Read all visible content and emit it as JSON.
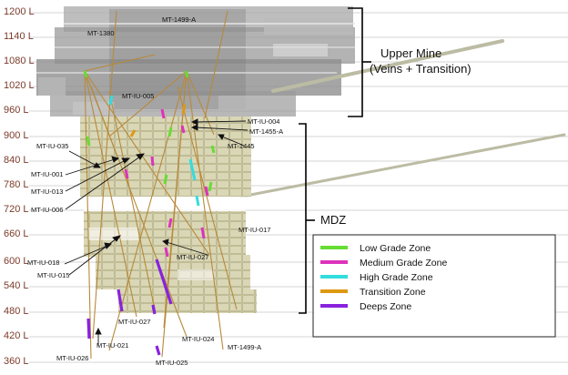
{
  "levels": [
    "1200 L",
    "1140 L",
    "1080 L",
    "1020 L",
    "960 L",
    "900 L",
    "840 L",
    "780 L",
    "720 L",
    "660 L",
    "600 L",
    "540 L",
    "480 L",
    "420 L",
    "360 L"
  ],
  "zones": {
    "upper_mine_title": "Upper Mine",
    "upper_mine_sub": "(Veins + Transition)",
    "mdz": "MDZ"
  },
  "holes": {
    "mt_1499_a_top": "MT-1499-A",
    "mt_1380": "MT-1380",
    "mt_iu_005": "MT-IU-005",
    "mt_iu_004": "MT-IU-004",
    "mt_1455_a": "MT-1455-A",
    "mt_1445": "MT-1445",
    "mt_iu_035": "MT-IU-035",
    "mt_iu_001": "MT-IU-001",
    "mt_iu_013": "MT-IU-013",
    "mt_iu_006": "MT-IU-006",
    "mt_iu_017": "MT-IU-017",
    "mt_iu_018": "MT-IU-018",
    "mt_iu_015": "MT-IU-015",
    "mt_iu_027_mid": "MT-IU-027",
    "mt_iu_027_low": "MT-IU-027",
    "mt_iu_021": "MT-IU-021",
    "mt_iu_024": "MT-IU-024",
    "mt_1499_a_low": "MT-1499-A",
    "mt_iu_026": "MT-IU-026",
    "mt_iu_025": "MT-IU-025"
  },
  "legend": [
    {
      "label": "Low Grade Zone",
      "color": "#66dd33"
    },
    {
      "label": "Medium Grade Zone",
      "color": "#dd33bb"
    },
    {
      "label": "High Grade Zone",
      "color": "#33dddd"
    },
    {
      "label": "Transition Zone",
      "color": "#dd9911"
    },
    {
      "label": "Deeps Zone",
      "color": "#8822dd"
    }
  ]
}
